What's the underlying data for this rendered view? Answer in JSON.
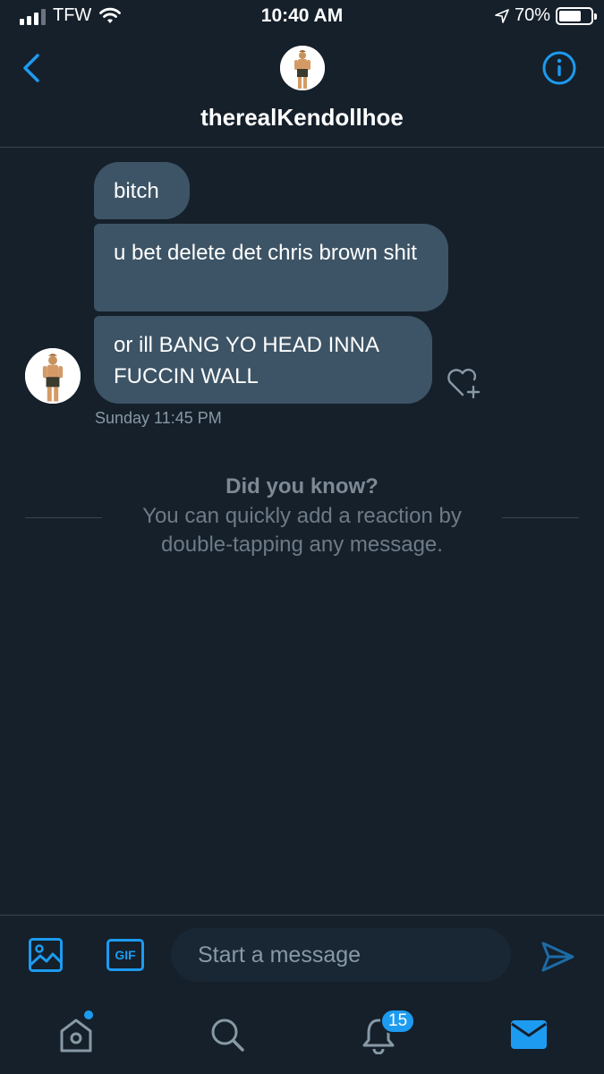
{
  "status_bar": {
    "carrier": "TFW",
    "time": "10:40 AM",
    "battery": "70%",
    "battery_level": 0.7
  },
  "header": {
    "title": "therealKendollhoe",
    "back_icon": "chevron-left-icon",
    "info_icon": "info-circle-icon"
  },
  "messages": [
    {
      "text": "bitch"
    },
    {
      "text": "u bet delete det chris brown shit"
    },
    {
      "text": "or ill BANG YO HEAD INNA FUCCIN WALL"
    }
  ],
  "message_timestamp": "Sunday 11:45 PM",
  "tip": {
    "title": "Did you know?",
    "body": "You can quickly add a reaction by double-tapping any message."
  },
  "composer": {
    "placeholder": "Start a message",
    "gif_label": "GIF"
  },
  "tabbar": {
    "notifications_badge": "15"
  },
  "colors": {
    "background": "#15202b",
    "bubble": "#3d5466",
    "accent": "#1d9bf0",
    "divider": "#38444d"
  }
}
